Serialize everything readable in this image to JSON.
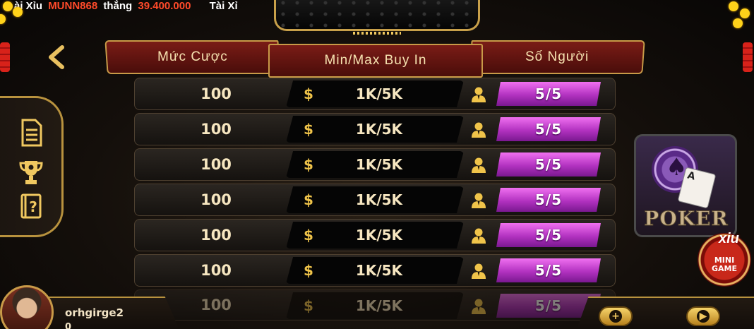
{
  "ticker": [
    {
      "prefix": "ài Xỉu",
      "name": "MUNN868",
      "verb": "thắng",
      "amount": "39.400.000"
    },
    {
      "prefix": "Tài Xỉ"
    }
  ],
  "headers": {
    "bet_level": "Mức Cược",
    "buy_in": "Min/Max Buy In",
    "players": "Số Người"
  },
  "rows": [
    {
      "bet": "100",
      "currency": "$",
      "buy_in": "1K/5K",
      "players": "5/5"
    },
    {
      "bet": "100",
      "currency": "$",
      "buy_in": "1K/5K",
      "players": "5/5"
    },
    {
      "bet": "100",
      "currency": "$",
      "buy_in": "1K/5K",
      "players": "5/5"
    },
    {
      "bet": "100",
      "currency": "$",
      "buy_in": "1K/5K",
      "players": "5/5"
    },
    {
      "bet": "100",
      "currency": "$",
      "buy_in": "1K/5K",
      "players": "5/5"
    },
    {
      "bet": "100",
      "currency": "$",
      "buy_in": "1K/5K",
      "players": "5/5"
    },
    {
      "bet": "100",
      "currency": "$",
      "buy_in": "1K/5K",
      "players": "5/5"
    }
  ],
  "poker": {
    "label": "POKER"
  },
  "mini_game": {
    "brand": "xiu",
    "line1": "MINI",
    "line2": "GAME"
  },
  "user": {
    "name": "orhgirge2",
    "balance": "0"
  },
  "colors": {
    "accent_gold": "#c89a48",
    "header_red": "#7a1c16",
    "players_pink": "#d24ae0",
    "ticker_red": "#ff4a2a"
  },
  "icons": {
    "back": "chevron-left-icon",
    "side": [
      "document-icon",
      "trophy-icon",
      "help-book-icon"
    ],
    "person": "person-icon",
    "controls": [
      "plus-icon",
      "play-icon"
    ]
  }
}
